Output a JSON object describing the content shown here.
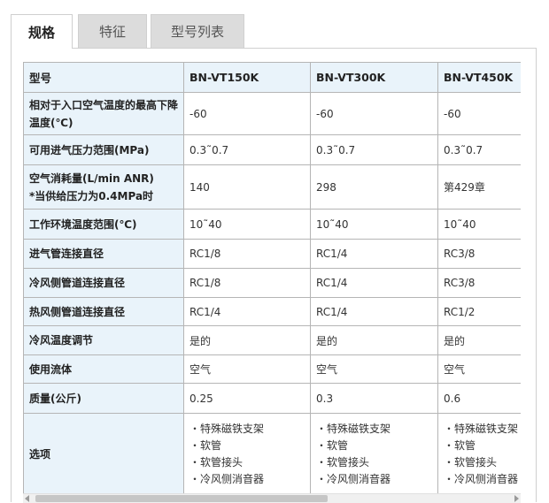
{
  "tabs": [
    {
      "label": "规格",
      "active": true
    },
    {
      "label": "特征",
      "active": false
    },
    {
      "label": "型号列表",
      "active": false
    }
  ],
  "table": {
    "header": [
      "型号",
      "BN-VT150K",
      "BN-VT300K",
      "BN-VT450K"
    ],
    "rows": [
      {
        "label": "相对于入口空气温度的最高下降温度(℃)",
        "values": [
          "-60",
          "-60",
          "-60"
        ]
      },
      {
        "label": "可用进气压力范围(MPa)",
        "values": [
          "0.3˜0.7",
          "0.3˜0.7",
          "0.3˜0.7"
        ]
      },
      {
        "label_lines": [
          "空气消耗量(L/min ANR)",
          "*当供给压力为0.4MPa时"
        ],
        "values": [
          "140",
          "298",
          "第429章"
        ]
      },
      {
        "label": "工作环境温度范围(℃)",
        "values": [
          "10˜40",
          "10˜40",
          "10˜40"
        ]
      },
      {
        "label": "进气管连接直径",
        "values": [
          "RC1/8",
          "RC1/4",
          "RC3/8"
        ]
      },
      {
        "label": "冷风侧管道连接直径",
        "values": [
          "RC1/8",
          "RC1/4",
          "RC3/8"
        ]
      },
      {
        "label": "热风侧管道连接直径",
        "values": [
          "RC1/4",
          "RC1/4",
          "RC1/2"
        ]
      },
      {
        "label": "冷风温度调节",
        "values": [
          "是的",
          "是的",
          "是的"
        ]
      },
      {
        "label": "使用流体",
        "values": [
          "空气",
          "空气",
          "空气"
        ]
      },
      {
        "label": "质量(公斤)",
        "values": [
          "0.25",
          "0.3",
          "0.6"
        ]
      },
      {
        "label": "选项",
        "options": [
          "・特殊磁铁支架",
          "・软管",
          "・软管接头",
          "・冷风侧消音器"
        ]
      }
    ]
  },
  "colors": {
    "label_bg": "#e9f3fa",
    "border": "#b5b5b5",
    "tab_inactive_bg": "#dcdcdc"
  }
}
